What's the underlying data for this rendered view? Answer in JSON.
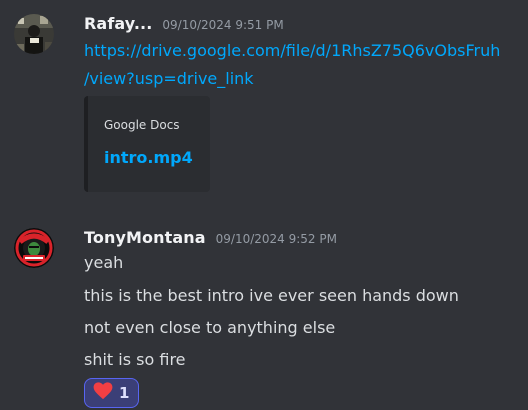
{
  "messages": [
    {
      "author": "Rafay...",
      "timestamp": "09/10/2024 9:51 PM",
      "link_line1": "https://drive.google.com/file/d/1RhsZ75Q6vObsFruh",
      "link_line2": "/view?usp=drive_link",
      "embed": {
        "provider": "Google Docs",
        "title": "intro.mp4"
      }
    },
    {
      "author": "TonyMontana",
      "timestamp": "09/10/2024 9:52 PM",
      "lines": [
        "yeah",
        "this is the best intro ive ever seen hands down",
        "not even close to anything else",
        "shit is so fire"
      ],
      "avatar_text": {
        "top": "SCARFACE",
        "bottom": "TRADES"
      },
      "reaction": {
        "emoji": "heart-icon",
        "count": "1"
      }
    }
  ],
  "colors": {
    "background": "#313338",
    "link": "#00a8fc",
    "reaction_border": "#5865f2",
    "heart": "#f23f43"
  }
}
